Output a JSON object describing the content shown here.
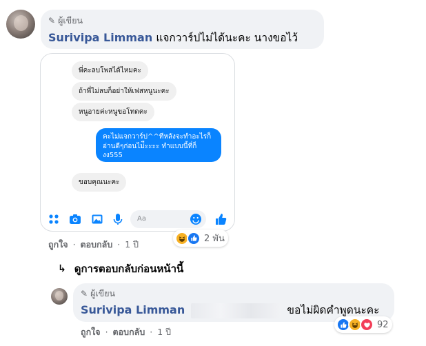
{
  "comment1": {
    "author_badge": "ผู้เขียน",
    "author_name": "Surivipa Limman",
    "text": "แจกวาร์ปไม่ได้นะคะ นางขอไว้",
    "screenshot": {
      "messages_in": [
        "พี่คะลบโพสได้ไหมคะ",
        "ถ้าพี่ไม่ลบก็อย่าให้เฟสหนูนะคะ",
        "หนูอายค่ะหนูขอโทดคะ"
      ],
      "message_out": "คะไม่แจกวาร์ป^^ทีหลังจะทำอะไรก็อ่านดีๆก่อนไม่ีะะะะ ทำแบบนี้ที่ก็งง555",
      "message_last": "ขอบคุณนะคะ",
      "input_placeholder": "Aa"
    },
    "actions": {
      "like": "ถูกใจ",
      "reply": "ตอบกลับ",
      "time": "1 ปี"
    },
    "reactions": {
      "count": "2 พัน",
      "icons": [
        "haha-icon",
        "like-icon"
      ]
    }
  },
  "view_previous": "ดูการตอบกลับก่อนหน้านี้",
  "comment2": {
    "author_badge": "ผู้เขียน",
    "author_name": "Surivipa Limman",
    "text": "ขอไม่ผิดคำพูดนะคะ",
    "actions": {
      "like": "ถูกใจ",
      "reply": "ตอบกลับ",
      "time": "1 ปี"
    },
    "reactions": {
      "count": "92",
      "icons": [
        "like-icon",
        "haha-icon",
        "love-icon"
      ]
    }
  },
  "separator": "·",
  "colors": {
    "name_link": "#385898",
    "bubble_bg": "#f0f2f5",
    "meta_text": "#65676b",
    "messenger_blue": "#0a84ff"
  }
}
